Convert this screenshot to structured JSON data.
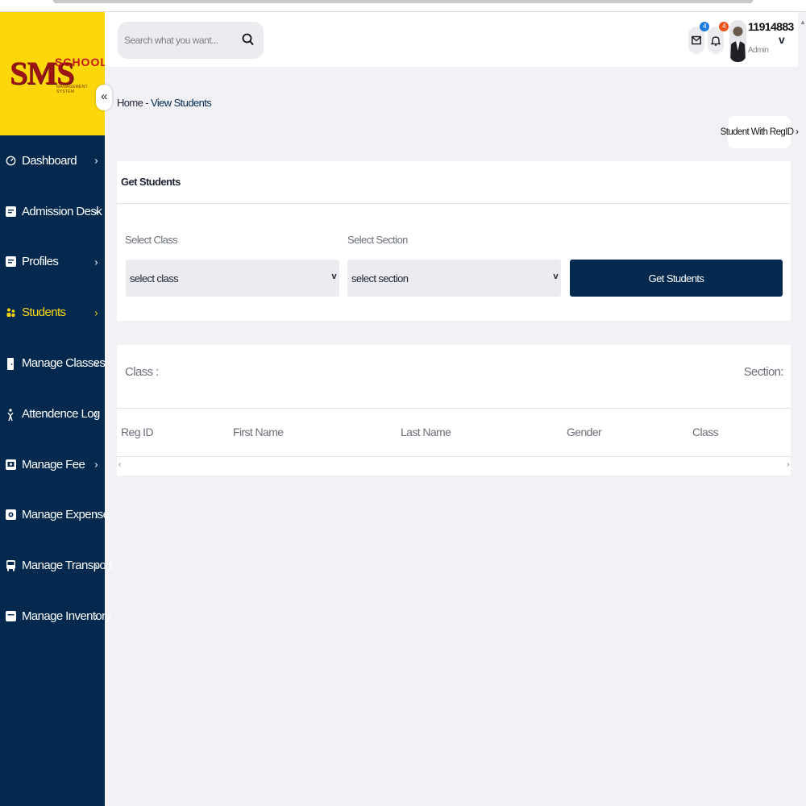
{
  "logo": {
    "brand": "SMS",
    "school": "SCHOOL",
    "tagline": "MANAGEMENT SYSTEM"
  },
  "sidebar": {
    "collapse_glyph": "«",
    "items": [
      {
        "label": "Dashboard",
        "icon": "dashboard-gauge-icon"
      },
      {
        "label": "Admission Desk",
        "icon": "admission-form-icon"
      },
      {
        "label": "Profiles",
        "icon": "profile-form-icon"
      },
      {
        "label": "Students",
        "icon": "students-group-icon",
        "active": true
      },
      {
        "label": "Manage Classes",
        "icon": "classroom-door-icon"
      },
      {
        "label": "Attendence Log",
        "icon": "attendance-person-icon"
      },
      {
        "label": "Manage Fee",
        "icon": "fee-card-icon"
      },
      {
        "label": "Manage Expense",
        "icon": "expense-wallet-icon"
      },
      {
        "label": "Manage Transport",
        "icon": "bus-icon"
      },
      {
        "label": "Manage Inventory",
        "icon": "inventory-box-icon"
      }
    ],
    "chevron": "›"
  },
  "header": {
    "search_placeholder": "Search what you want...",
    "mail_badge": "4",
    "bell_badge": "4",
    "user_name": "11914883",
    "user_role": "Admin",
    "user_chevron": "v"
  },
  "breadcrumb": {
    "home": "Home",
    "separator": " - ",
    "current": "View Students"
  },
  "actions": {
    "regid_button": "Student With RegID ›"
  },
  "get_students_card": {
    "title": "Get Students",
    "class_label": "Select Class",
    "class_value": "select class",
    "section_label": "Select Section",
    "section_value": "select section",
    "dropdown_arrow": "v",
    "submit_label": "Get Students"
  },
  "results": {
    "class_label": "Class :",
    "section_label": "Section:",
    "columns": [
      "Reg ID",
      "First Name",
      "Last Name",
      "Gender",
      "Class"
    ],
    "scroll_left": "‹",
    "scroll_right": "›"
  },
  "colors": {
    "sidebar_bg": "#03294f",
    "logo_bg": "#fcd70b",
    "active_nav": "#fcd70b",
    "primary_button": "#03294f",
    "mail_badge": "#1e7be0",
    "bell_badge": "#f0531c"
  }
}
